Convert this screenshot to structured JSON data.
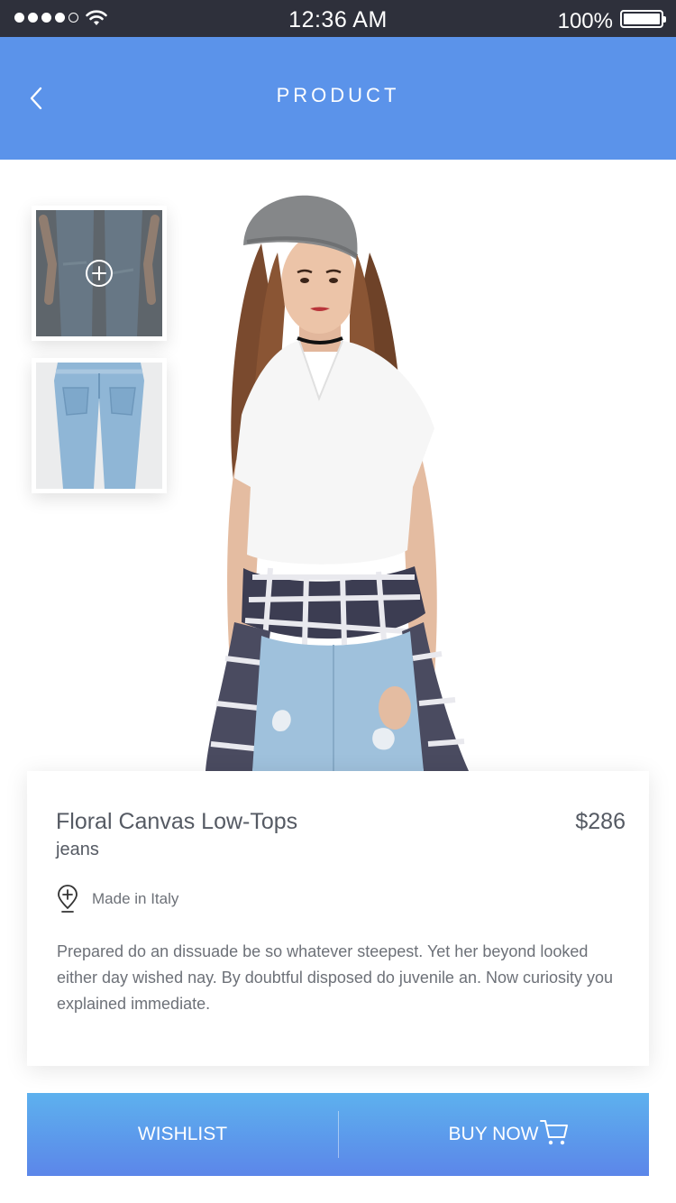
{
  "status_bar": {
    "time": "12:36 AM",
    "battery_percent": "100%",
    "signal_strength": 4,
    "signal_max": 5
  },
  "nav": {
    "title": "PRODUCT",
    "back_icon": "chevron-left-icon"
  },
  "thumbnails": [
    {
      "name": "thumbnail-front",
      "icon": "zoom-plus-icon",
      "selected": true
    },
    {
      "name": "thumbnail-back",
      "icon": null,
      "selected": false
    }
  ],
  "product": {
    "name": "Floral Canvas Low-Tops",
    "category": "jeans",
    "price": "$286",
    "origin": "Made in Italy",
    "origin_icon": "location-pin-icon",
    "description": "Prepared do an dissuade be so whatever steepest. Yet her beyond looked either day wished nay. By doubtful disposed do juvenile an. Now curiosity you explained immediate."
  },
  "actions": {
    "wishlist_label": "WISHLIST",
    "buy_label": "BUY NOW",
    "buy_icon": "cart-icon"
  },
  "colors": {
    "nav_blue": "#5b93ea",
    "status_bar": "#2e303b",
    "gradient_top": "#5db1ee",
    "gradient_bottom": "#5c86e9",
    "text": "#555a63"
  }
}
